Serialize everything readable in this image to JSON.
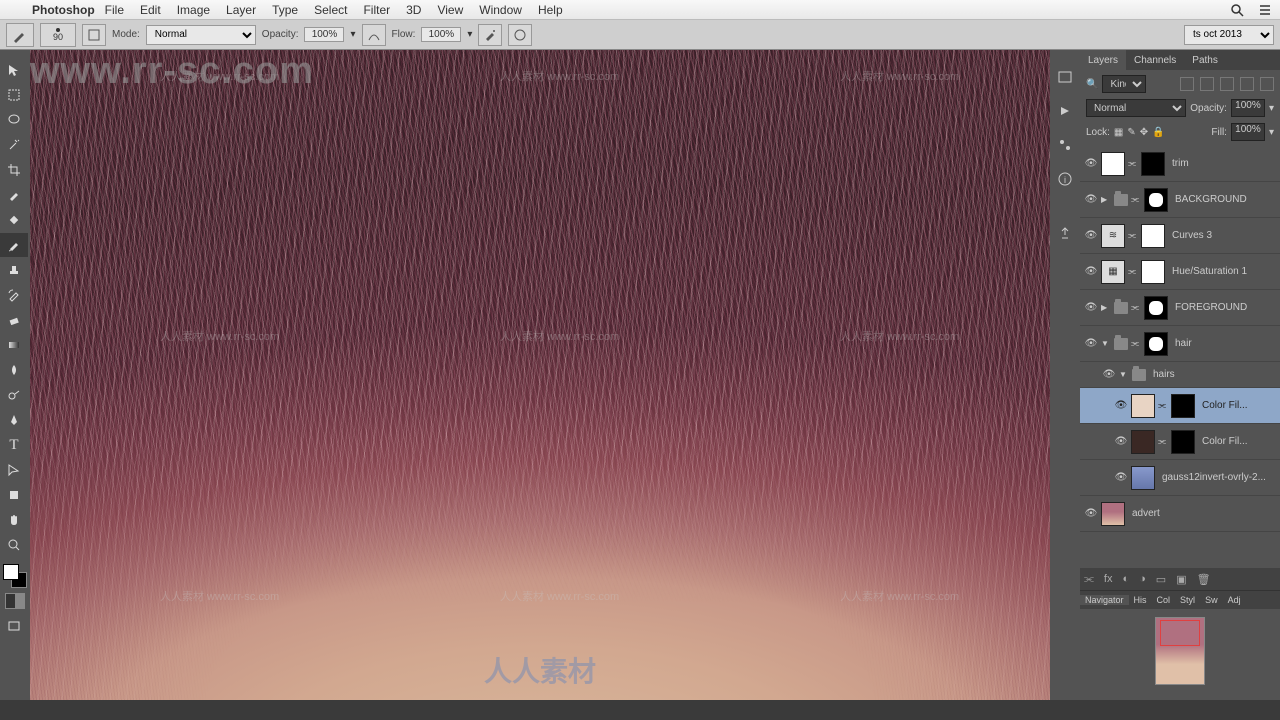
{
  "menubar": {
    "app": "Photoshop",
    "items": [
      "File",
      "Edit",
      "Image",
      "Layer",
      "Type",
      "Select",
      "Filter",
      "3D",
      "View",
      "Window",
      "Help"
    ]
  },
  "optbar": {
    "brush_size": "90",
    "mode_label": "Mode:",
    "mode_value": "Normal",
    "opacity_label": "Opacity:",
    "opacity_value": "100%",
    "flow_label": "Flow:",
    "flow_value": "100%",
    "workspace": "ts oct 2013"
  },
  "watermark_top": "www.rr-sc.com",
  "watermark_small": "人人素材\nwww.rr-sc.com",
  "watermark_logo": "人人素材",
  "layers_panel": {
    "tabs": [
      "Layers",
      "Channels",
      "Paths"
    ],
    "kind_label": "Kind",
    "blend_mode": "Normal",
    "opacity_label": "Opacity:",
    "opacity_value": "100%",
    "lock_label": "Lock:",
    "fill_label": "Fill:",
    "fill_value": "100%",
    "layers": [
      {
        "name": "trim",
        "type": "layer",
        "mask": true
      },
      {
        "name": "BACKGROUND",
        "type": "group",
        "mask": "black",
        "arrow": "▶"
      },
      {
        "name": "Curves 3",
        "type": "adj",
        "icon": "≋",
        "mask": true
      },
      {
        "name": "Hue/Saturation 1",
        "type": "adj",
        "icon": "▦",
        "mask": true
      },
      {
        "name": "FOREGROUND",
        "type": "group",
        "mask": "black",
        "arrow": "▶"
      },
      {
        "name": "hair",
        "type": "group",
        "mask": "black",
        "arrow": "▼"
      },
      {
        "name": "hairs",
        "type": "subgroup",
        "arrow": "▼"
      },
      {
        "name": "Color Fil...",
        "type": "sublayer",
        "thumb": "#e8d4c4",
        "mask": "black",
        "selected": true
      },
      {
        "name": "Color Fil...",
        "type": "sublayer",
        "thumb": "#3a2824",
        "mask": "black"
      },
      {
        "name": "gauss12invert-ovrly-2...",
        "type": "sublayer",
        "thumb": "img"
      },
      {
        "name": "advert",
        "type": "layer",
        "thumb": "img"
      }
    ]
  },
  "nav_panel": {
    "tabs": [
      "Navigator",
      "His",
      "Col",
      "Styl",
      "Sw",
      "Adj"
    ]
  }
}
